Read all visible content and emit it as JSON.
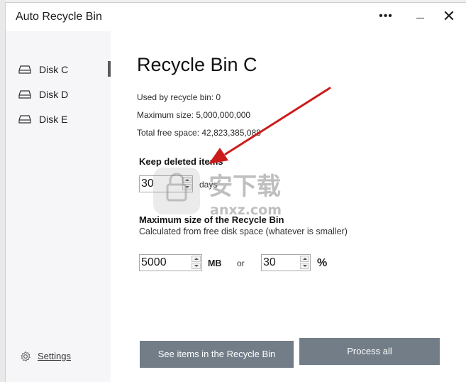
{
  "window": {
    "title": "Auto Recycle Bin"
  },
  "colors": {
    "accent_button": "#727d88",
    "sidebar_bg": "#f6f5f7",
    "annotation_arrow": "#cc1b1b"
  },
  "sidebar": {
    "items": [
      {
        "label": "Disk C",
        "icon": "disk-icon",
        "selected": true
      },
      {
        "label": "Disk D",
        "icon": "disk-icon",
        "selected": false
      },
      {
        "label": "Disk E",
        "icon": "disk-icon",
        "selected": false
      }
    ],
    "settings_label": "Settings",
    "settings_icon": "gear-icon"
  },
  "main": {
    "title": "Recycle Bin C",
    "info": {
      "used": "Used by recycle bin: 0",
      "maximum": "Maximum size: 5,000,000,000",
      "free": "Total free space: 42,823,385,088"
    },
    "keep": {
      "title": "Keep deleted items",
      "value": "30",
      "unit": "days"
    },
    "maxsize": {
      "title": "Maximum size of the Recycle Bin",
      "subtitle": "Calculated from free disk space (whatever is smaller)",
      "mb_value": "5000",
      "mb_unit": "MB",
      "or_label": "or",
      "percent_value": "30",
      "percent_unit": "%"
    },
    "buttons": {
      "see_items": "See items in the Recycle Bin",
      "process_all": "Process all"
    }
  },
  "watermark": {
    "main": "安下载",
    "sub": "anxz.com"
  }
}
